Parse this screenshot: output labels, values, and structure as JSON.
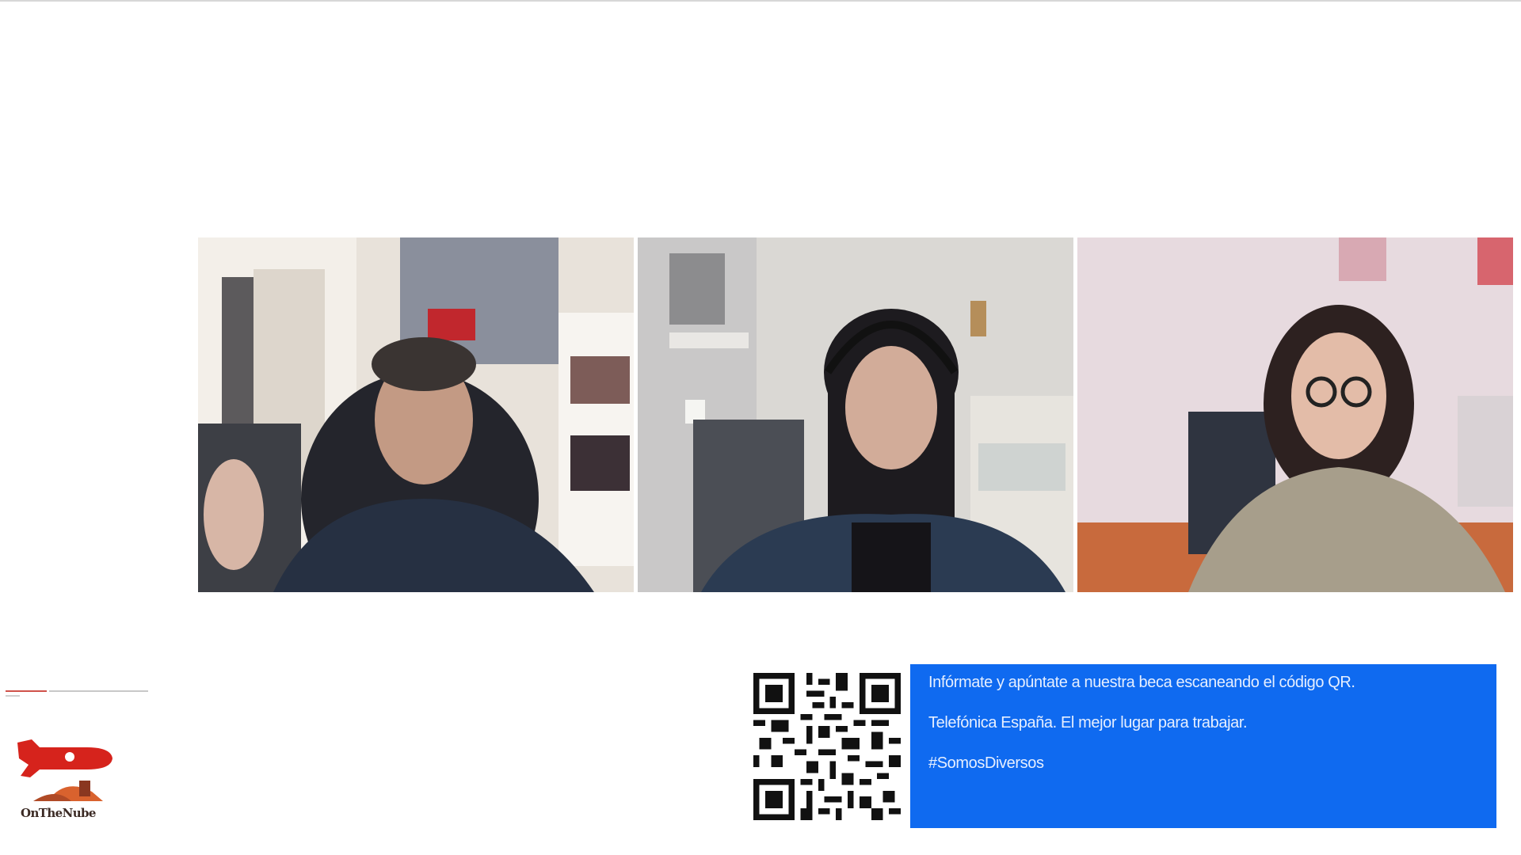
{
  "participants": [
    {
      "name": "participant-1",
      "label": "Participant video 1"
    },
    {
      "name": "participant-2",
      "label": "Participant video 2"
    },
    {
      "name": "participant-3",
      "label": "Participant video 3"
    }
  ],
  "banner": {
    "line1": "Infórmate y apúntate a nuestra beca escaneando el código QR.",
    "line2": "Telefónica España. El mejor lugar para trabajar.",
    "line3": "#SomosDiversos",
    "bg_color": "#0f6af0"
  },
  "logo": {
    "text": "OnTheNube",
    "icon": "rocket-logo-icon"
  }
}
